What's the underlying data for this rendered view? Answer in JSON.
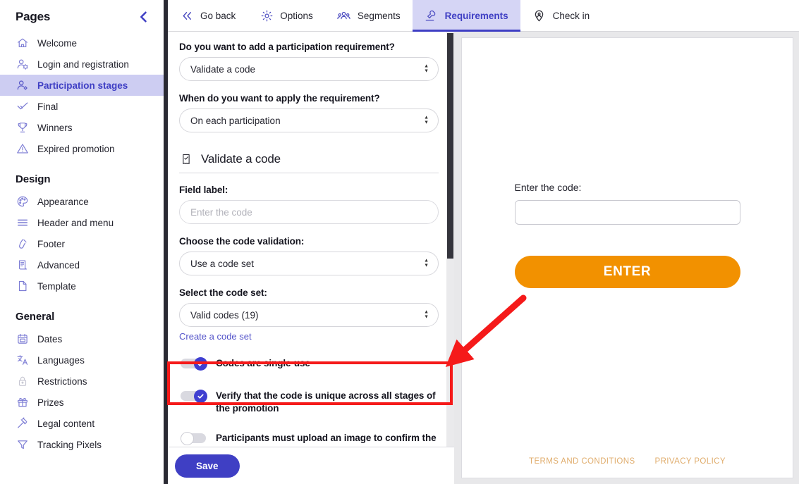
{
  "sidebar": {
    "title": "Pages",
    "collapse_icon": "chevron-left-icon",
    "groups": [
      {
        "title": null,
        "items": [
          {
            "label": "Welcome",
            "icon": "home-icon",
            "active": false
          },
          {
            "label": "Login and registration",
            "icon": "user-settings-icon",
            "active": false
          },
          {
            "label": "Participation stages",
            "icon": "user-stages-icon",
            "active": true
          },
          {
            "label": "Final",
            "icon": "check-icon",
            "active": false
          },
          {
            "label": "Winners",
            "icon": "trophy-icon",
            "active": false
          },
          {
            "label": "Expired promotion",
            "icon": "warning-triangle-icon",
            "active": false
          }
        ]
      },
      {
        "title": "Design",
        "items": [
          {
            "label": "Appearance",
            "icon": "palette-icon",
            "active": false
          },
          {
            "label": "Header and menu",
            "icon": "menu-lines-icon",
            "active": false
          },
          {
            "label": "Footer",
            "icon": "footer-shoe-icon",
            "active": false
          },
          {
            "label": "Advanced",
            "icon": "document-code-icon",
            "active": false
          },
          {
            "label": "Template",
            "icon": "page-icon",
            "active": false
          }
        ]
      },
      {
        "title": "General",
        "items": [
          {
            "label": "Dates",
            "icon": "calendar-icon",
            "active": false
          },
          {
            "label": "Languages",
            "icon": "translate-icon",
            "active": false
          },
          {
            "label": "Restrictions",
            "icon": "lock-icon",
            "active": false
          },
          {
            "label": "Prizes",
            "icon": "gift-icon",
            "active": false
          },
          {
            "label": "Legal content",
            "icon": "gavel-icon",
            "active": false
          },
          {
            "label": "Tracking Pixels",
            "icon": "funnel-icon",
            "active": false
          }
        ]
      }
    ]
  },
  "tabs": [
    {
      "label": "Go back",
      "icon": "double-chevron-left-icon",
      "active": false
    },
    {
      "label": "Options",
      "icon": "gear-icon",
      "active": false
    },
    {
      "label": "Segments",
      "icon": "segments-people-icon",
      "active": false
    },
    {
      "label": "Requirements",
      "icon": "stamp-icon",
      "active": true
    },
    {
      "label": "Check in",
      "icon": "location-pin-person-icon",
      "active": false
    }
  ],
  "form": {
    "requirement_question_label": "Do you want to add a participation requirement?",
    "requirement_value": "Validate a code",
    "apply_question_label": "When do you want to apply the requirement?",
    "apply_value": "On each participation",
    "section": {
      "icon": "ticket-check-icon",
      "title": "Validate a code"
    },
    "field_label_label": "Field label:",
    "field_label_placeholder": "Enter the code",
    "field_label_value": "",
    "validation_label": "Choose the code validation:",
    "validation_value": "Use a code set",
    "code_set_label": "Select the code set:",
    "code_set_value": "Valid codes (19)",
    "create_code_set_link": "Create a code set",
    "toggles": [
      {
        "label": "Codes are single-use",
        "on": true,
        "highlighted": false
      },
      {
        "label": "Verify that the code is unique across all stages of the promotion",
        "on": true,
        "highlighted": true
      },
      {
        "label": "Participants must upload an image to confirm the code",
        "on": false,
        "highlighted": false
      }
    ],
    "save_label": "Save"
  },
  "preview": {
    "code_label": "Enter the code:",
    "code_input_value": "",
    "enter_button_label": "ENTER",
    "footer_links": [
      "TERMS AND CONDITIONS",
      "PRIVACY POLICY"
    ]
  },
  "colors": {
    "brand_indigo": "#3f3fc4",
    "active_sidebar_bg": "#cdcdf2",
    "active_tab_bg": "#d5d5f5",
    "toggle_on": "#3f3fd1",
    "preview_cta_orange": "#f29100",
    "footer_link": "#e0ad6d",
    "annotation_red": "#f51a1a"
  },
  "annotations": {
    "highlight_target": "Verify that the code is unique across all stages of the promotion",
    "arrow": "red-arrow-pointing-down-left"
  }
}
